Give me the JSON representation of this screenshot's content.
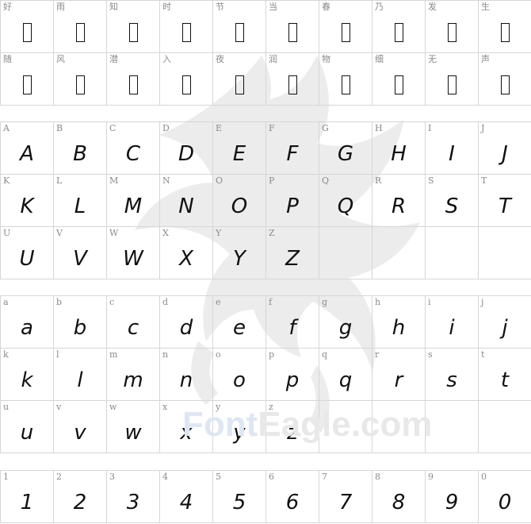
{
  "cjk_rows": [
    [
      "好",
      "雨",
      "知",
      "时",
      "节",
      "当",
      "春",
      "乃",
      "发",
      "生"
    ],
    [
      "随",
      "风",
      "潜",
      "入",
      "夜",
      "润",
      "物",
      "细",
      "无",
      "声"
    ]
  ],
  "upper_rows": [
    [
      "A",
      "B",
      "C",
      "D",
      "E",
      "F",
      "G",
      "H",
      "I",
      "J"
    ],
    [
      "K",
      "L",
      "M",
      "N",
      "O",
      "P",
      "Q",
      "R",
      "S",
      "T"
    ],
    [
      "U",
      "V",
      "W",
      "X",
      "Y",
      "Z",
      "",
      "",
      "",
      ""
    ]
  ],
  "lower_rows": [
    [
      "a",
      "b",
      "c",
      "d",
      "e",
      "f",
      "g",
      "h",
      "i",
      "j"
    ],
    [
      "k",
      "l",
      "m",
      "n",
      "o",
      "p",
      "q",
      "r",
      "s",
      "t"
    ],
    [
      "u",
      "v",
      "w",
      "x",
      "y",
      "z",
      "",
      "",
      "",
      ""
    ]
  ],
  "digit_row": [
    "1",
    "2",
    "3",
    "4",
    "5",
    "6",
    "7",
    "8",
    "9",
    "0"
  ],
  "watermark": {
    "brand_a": "Font",
    "brand_b": "Eagle.com"
  },
  "colors": {
    "grid": "#d6d6d6",
    "label": "#8a8a8a",
    "glyph": "#111111",
    "watermark": "#e8e8e8"
  }
}
